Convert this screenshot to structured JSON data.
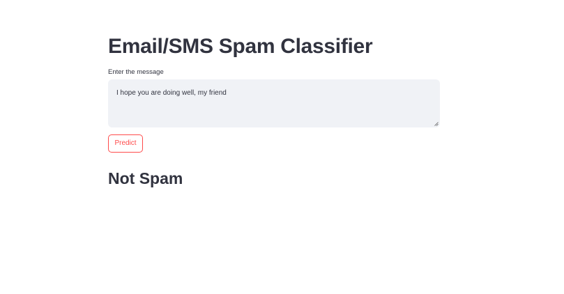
{
  "page": {
    "title": "Email/SMS Spam Classifier"
  },
  "form": {
    "message_label": "Enter the message",
    "message_value": "I hope you are doing well, my friend",
    "predict_label": "Predict"
  },
  "result": {
    "text": "Not Spam"
  },
  "colors": {
    "accent": "#ff4b4b",
    "text": "#31333f",
    "input_background": "#f0f2f6",
    "background": "#ffffff"
  },
  "icons": {
    "resize_handle": "resize-grip-icon"
  }
}
